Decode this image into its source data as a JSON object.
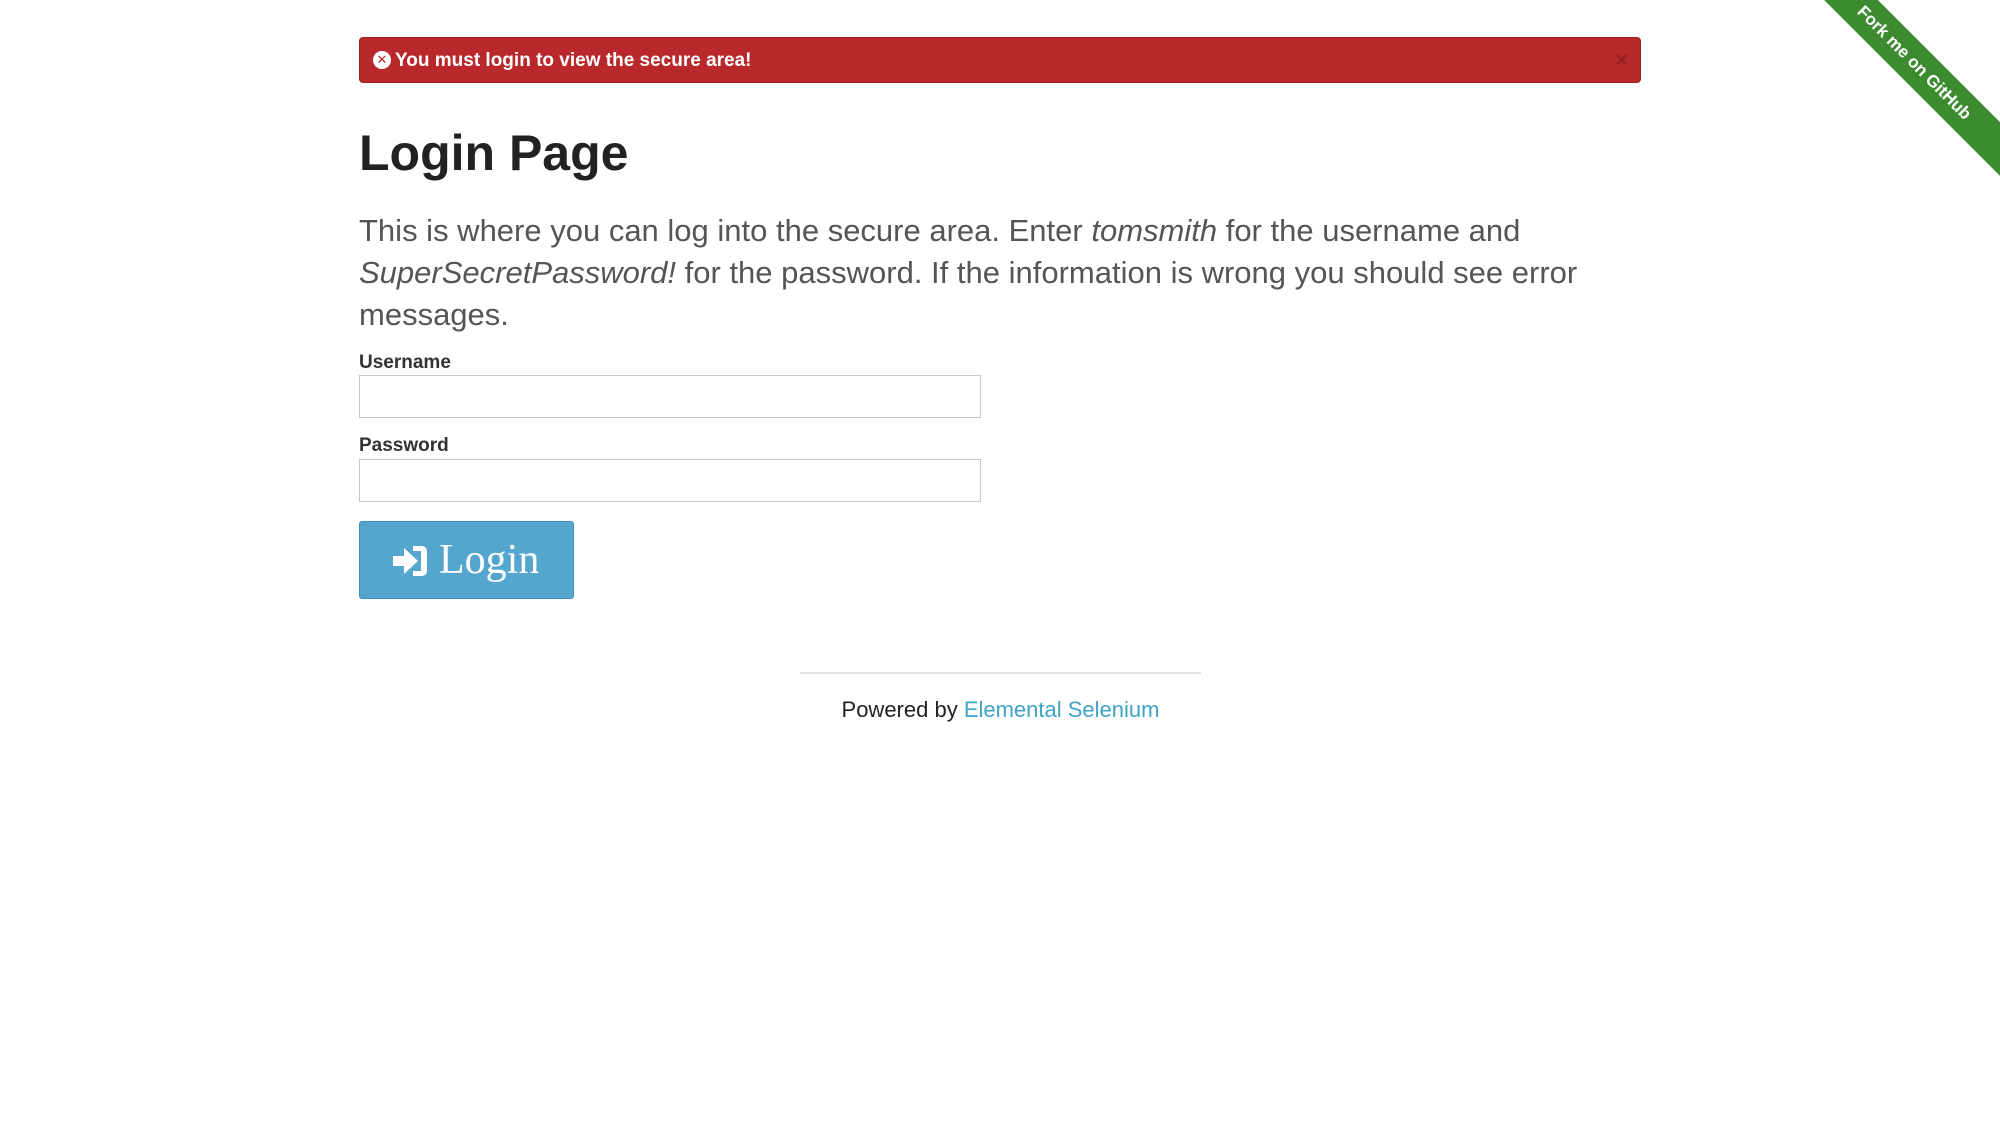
{
  "flash": {
    "icon": "x-circle-icon",
    "message": "You must login to view the secure area!",
    "close_label": "×",
    "color": "#b9292b"
  },
  "page": {
    "title": "Login Page",
    "desc_part1": "This is where you can log into the secure area. Enter ",
    "desc_username": "tomsmith",
    "desc_part2": " for the username and ",
    "desc_password": "SuperSecretPassword!",
    "desc_part3": " for the password. If the information is wrong you should see error messages."
  },
  "form": {
    "username_label": "Username",
    "username_value": "",
    "password_label": "Password",
    "password_value": "",
    "login_icon": "sign-in-icon",
    "login_label": "Login",
    "login_color": "#55a6cf"
  },
  "footer": {
    "prefix": "Powered by ",
    "link_text": "Elemental Selenium"
  },
  "ribbon": {
    "text": "Fork me on GitHub",
    "color": "#3d8b2f"
  }
}
